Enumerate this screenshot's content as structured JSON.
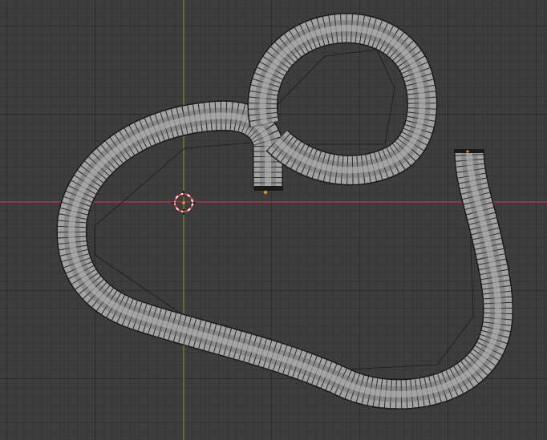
{
  "viewport": {
    "background": "#3d3d3d",
    "x_axis_color": "#c0394f",
    "y_axis_color": "#7a9a2f",
    "wire_color": "#1a1a1a",
    "tube_fill": "#a6a6a6",
    "tube_outline": "#1a1a1a",
    "origin_color": "#e39531",
    "cursor_primary_color": "#ff3333",
    "cursor_secondary_color": "#ffffff"
  },
  "scene": {
    "object": "curve-tube",
    "shading": "wireframe-over-solid",
    "selected_point": "origin-dot"
  }
}
